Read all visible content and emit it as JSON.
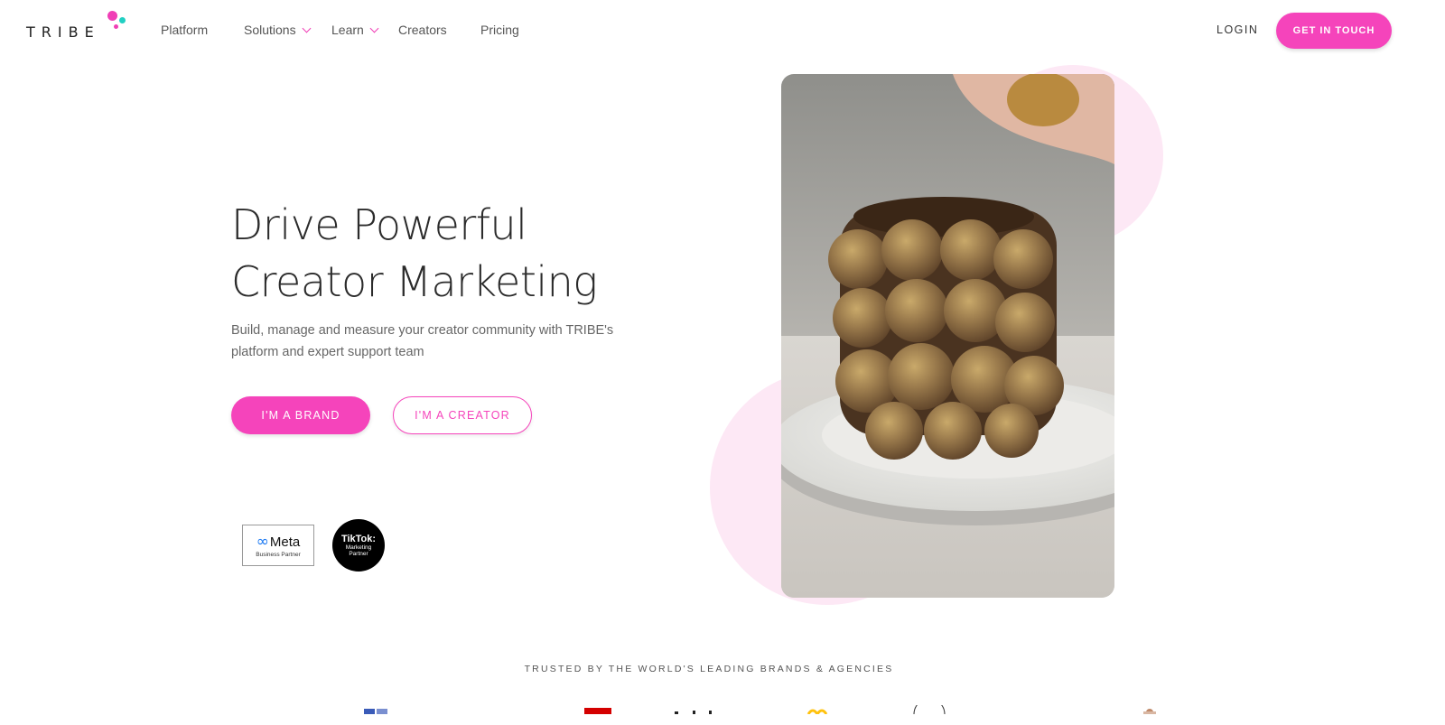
{
  "brand": {
    "name": "TRIBE",
    "accent": "#f544bb",
    "teal": "#21d0c3"
  },
  "nav": {
    "items": [
      {
        "label": "Platform",
        "has_dropdown": false
      },
      {
        "label": "Solutions",
        "has_dropdown": true
      },
      {
        "label": "Learn",
        "has_dropdown": true
      },
      {
        "label": "Creators",
        "has_dropdown": false
      },
      {
        "label": "Pricing",
        "has_dropdown": false
      }
    ],
    "login": "LOGIN",
    "cta": "GET IN TOUCH"
  },
  "hero": {
    "title_line1": "Drive Powerful",
    "title_line2": "Creator Marketing",
    "subtitle": "Build, manage and measure your creator community with TRIBE's platform and expert support team",
    "brand_button": "I'M A BRAND",
    "creator_button": "I'M A CREATOR"
  },
  "badges": {
    "meta_name": "Meta",
    "meta_sub": "Business Partner",
    "tiktok_name": "TikTok:",
    "tiktok_sub1": "Marketing",
    "tiktok_sub2": "Partner"
  },
  "media": {
    "icon": "chocolate-cake-image"
  },
  "trusted": {
    "heading": "TRUSTED BY THE WORLD'S LEADING BRANDS & AGENCIES"
  }
}
